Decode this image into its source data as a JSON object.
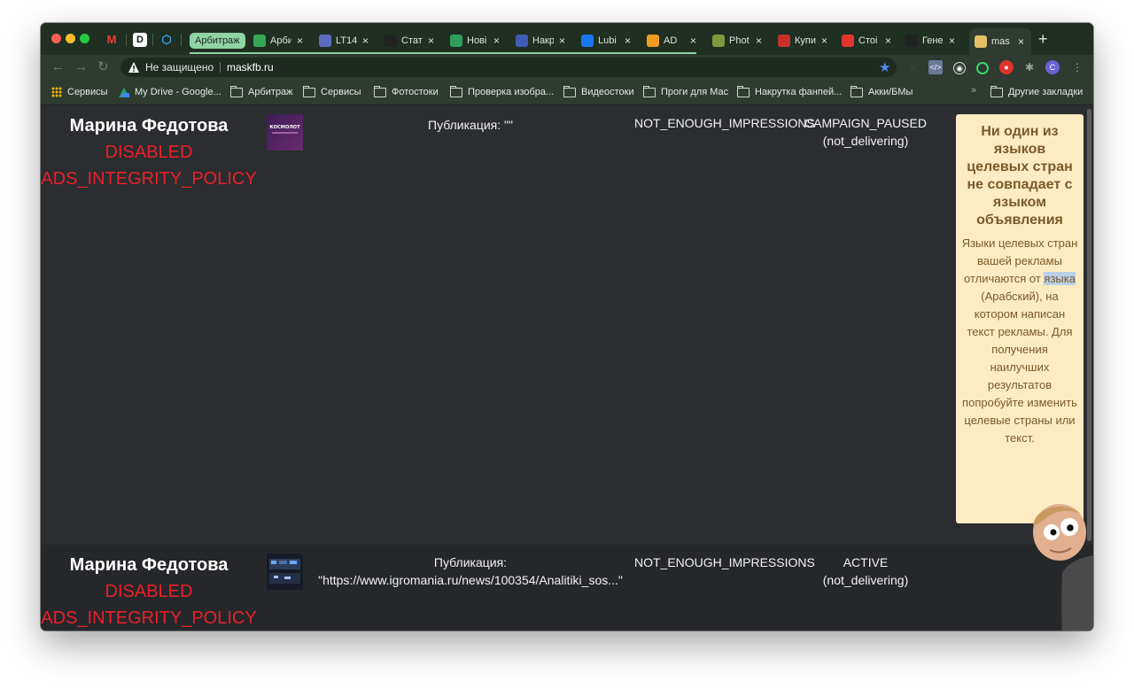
{
  "browser": {
    "group_label": "Арбитраж",
    "tabs": [
      {
        "title": "Арбитраж",
        "color": "#34a853"
      },
      {
        "title": "LT14",
        "color": "#5c6bc0"
      },
      {
        "title": "Стат",
        "color": "#222222"
      },
      {
        "title": "Нові",
        "color": "#2e9e5b"
      },
      {
        "title": "Накр",
        "color": "#3f5bb5"
      },
      {
        "title": "Lubi",
        "color": "#1877f2"
      },
      {
        "title": "AD",
        "color": "#f29c1f"
      },
      {
        "title": "Phot",
        "color": "#7a9b3a"
      },
      {
        "title": "Купи",
        "color": "#c7312b"
      },
      {
        "title": "Стоі",
        "color": "#e0362c"
      },
      {
        "title": "Гене",
        "color": "#222222"
      },
      {
        "title": "mas",
        "color": "#e2c063"
      }
    ],
    "tab_close_glyph": "×",
    "new_tab_glyph": "+",
    "address": {
      "security_text": "Не защищено",
      "url": "maskfb.ru"
    },
    "bookmarks": [
      {
        "label": "Сервисы",
        "icon": "apps-icon"
      },
      {
        "label": "My Drive - Google...",
        "icon": "google-drive-icon"
      },
      {
        "label": "Арбитраж",
        "icon": "folder-icon"
      },
      {
        "label": "Сервисы",
        "icon": "folder-icon"
      },
      {
        "label": "Фотостоки",
        "icon": "folder-icon"
      },
      {
        "label": "Проверка изобра...",
        "icon": "folder-icon"
      },
      {
        "label": "Видеостоки",
        "icon": "folder-icon"
      },
      {
        "label": "Проги для Мас",
        "icon": "folder-icon"
      },
      {
        "label": "Накрутка фанпей...",
        "icon": "folder-icon"
      },
      {
        "label": "Акки/БМы",
        "icon": "folder-icon"
      }
    ],
    "other_bookmarks": "Другие закладки",
    "chevron": "»",
    "profile_letter": "C"
  },
  "rows": [
    {
      "name": "Марина Федотова",
      "status": "DISABLED",
      "policy": "ADS_INTEGRITY_POLICY",
      "thumb_text": "КОСМОЛОТ",
      "publication_label": "Публикация:",
      "publication_value": "\"\"",
      "reason": "NOT_ENOUGH_IMPRESSIONS",
      "campaign_status": "CAMPAIGN_PAUSED",
      "delivery": "(not_delivering)"
    },
    {
      "name": "Марина Федотова",
      "status": "DISABLED",
      "policy": "ADS_INTEGRITY_POLICY",
      "publication_label": "Публикация:",
      "publication_value": "\"https://www.igromania.ru/news/100354/Analitiki_sos...\"",
      "reason": "NOT_ENOUGH_IMPRESSIONS",
      "campaign_status": "ACTIVE",
      "delivery": "(not_delivering)"
    }
  ],
  "tooltip": {
    "title": "Ни один из языков целевых стран не совпадает с языком объявления",
    "body_before": "Языки целевых стран вашей рекламы отличаются от ",
    "body_highlight": "языка",
    "body_after": " (Арабский), на котором написан текст рекламы. Для получения наилучших результатов попробуйте изменить целевые страны или текст."
  },
  "colors": {
    "status_red": "#e8202a",
    "tooltip_bg": "#fdecc2",
    "tab_group": "#8fd3a3"
  }
}
